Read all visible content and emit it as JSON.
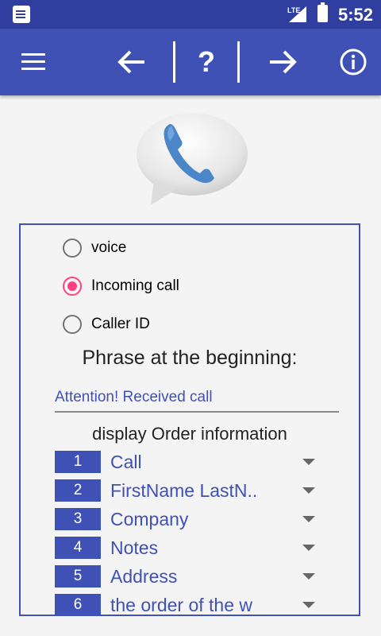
{
  "status_bar": {
    "network": "LTE",
    "time": "5:52",
    "icons": [
      "notification-icon",
      "signal-icon",
      "battery-icon"
    ]
  },
  "toolbar": {
    "icons": [
      "menu-icon",
      "back-arrow-icon",
      "help-icon",
      "forward-arrow-icon",
      "info-icon"
    ],
    "help_label": "?",
    "color": "#3f51b5",
    "status_color": "#303f9f"
  },
  "header_image": "phone-chat-bubble-icon",
  "options": [
    {
      "label": "voice",
      "checked": false
    },
    {
      "label": "Incoming call",
      "checked": true
    },
    {
      "label": "Caller ID",
      "checked": false
    }
  ],
  "phrase": {
    "title": "Phrase at the beginning:",
    "value": "Attention! Received call"
  },
  "order": {
    "title": "display Order information",
    "items": [
      {
        "num": "1",
        "label": "Call"
      },
      {
        "num": "2",
        "label": "FirstName LastN.."
      },
      {
        "num": "3",
        "label": "Company"
      },
      {
        "num": "4",
        "label": "Notes"
      },
      {
        "num": "5",
        "label": "Address"
      },
      {
        "num": "6",
        "label": "the order of the w"
      }
    ]
  },
  "accent_color": "#ff4081"
}
